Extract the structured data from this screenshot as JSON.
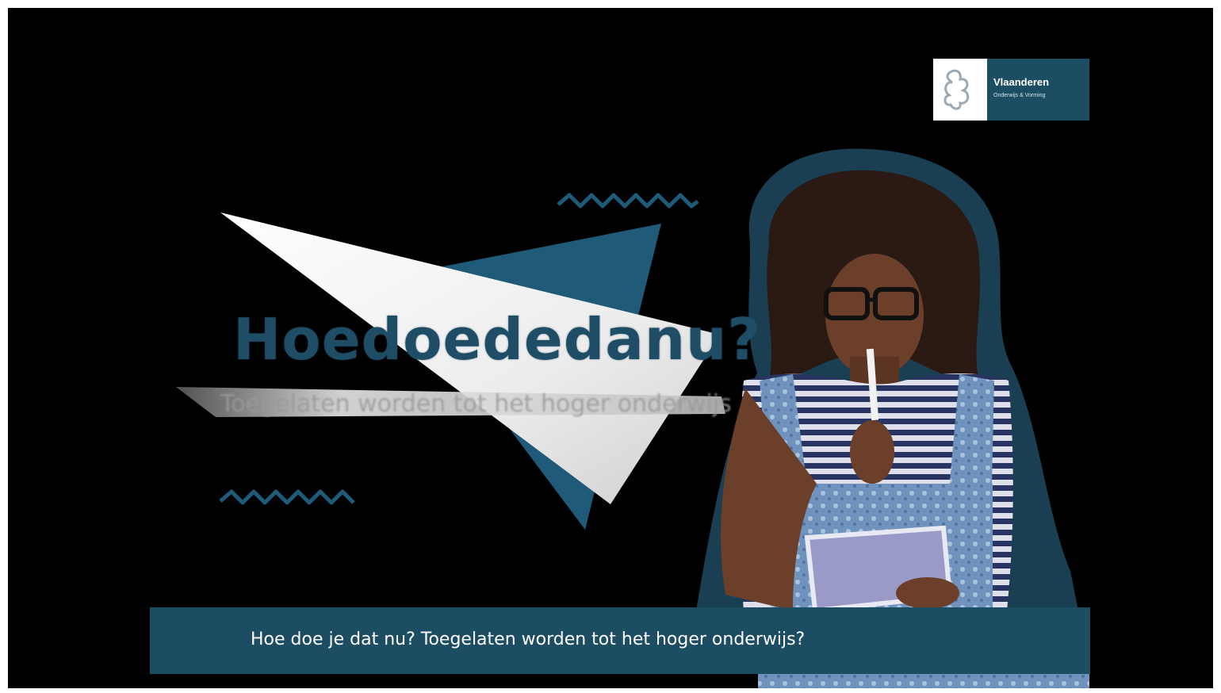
{
  "video": {
    "title": "Hoedoededanu?",
    "subtitle": "Toegelaten worden tot het hoger onderwijs",
    "caption": "Hoe doe je dat nu? Toegelaten worden tot het hoger onderwijs?"
  },
  "logo": {
    "name": "Vlaanderen",
    "tagline": "Onderwijs & Vorming"
  },
  "colors": {
    "background": "#000000",
    "accent": "#1d4d63",
    "triangle_light": "#eeeeee",
    "outline": "#23495c"
  }
}
